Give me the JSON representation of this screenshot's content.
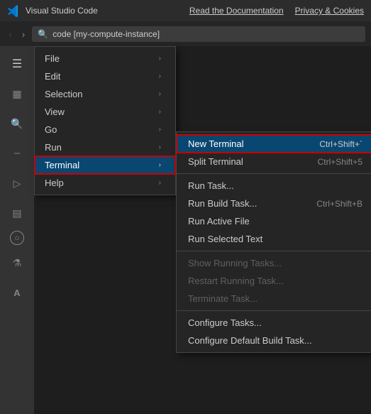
{
  "topBar": {
    "appTitle": "Visual Studio Code",
    "links": [
      "Read the Documentation",
      "Privacy & Cookies"
    ]
  },
  "addressBar": {
    "backBtn": "‹",
    "forwardBtn": "›",
    "searchIcon": "🔍",
    "addressText": "code [my-compute-instance]"
  },
  "activityBar": {
    "icons": [
      {
        "name": "hamburger",
        "symbol": "☰",
        "active": false
      },
      {
        "name": "explorer",
        "symbol": "⧉",
        "active": false
      },
      {
        "name": "search",
        "symbol": "🔍",
        "active": false
      },
      {
        "name": "source-control",
        "symbol": "⎇",
        "active": false
      },
      {
        "name": "run",
        "symbol": "▷",
        "active": false
      },
      {
        "name": "extensions",
        "symbol": "⊞",
        "active": false
      },
      {
        "name": "remote",
        "symbol": "⊙",
        "active": false
      },
      {
        "name": "flask",
        "symbol": "🧪",
        "active": false
      },
      {
        "name": "account",
        "symbol": "A",
        "active": false
      }
    ]
  },
  "fileMenu": {
    "items": [
      {
        "label": "File",
        "hasArrow": true
      },
      {
        "label": "Edit",
        "hasArrow": true
      },
      {
        "label": "Selection",
        "hasArrow": true
      },
      {
        "label": "View",
        "hasArrow": true
      },
      {
        "label": "Go",
        "hasArrow": true
      },
      {
        "label": "Run",
        "hasArrow": true
      },
      {
        "label": "Terminal",
        "hasArrow": true,
        "highlighted": true
      },
      {
        "label": "Help",
        "hasArrow": true
      }
    ]
  },
  "terminalSubmenu": {
    "items": [
      {
        "label": "New Terminal",
        "shortcut": "Ctrl+Shift+`",
        "highlighted": true,
        "disabled": false
      },
      {
        "label": "Split Terminal",
        "shortcut": "Ctrl+Shift+5",
        "highlighted": false,
        "disabled": false
      },
      {
        "label": "",
        "separator": true
      },
      {
        "label": "Run Task...",
        "shortcut": "",
        "highlighted": false,
        "disabled": false
      },
      {
        "label": "Run Build Task...",
        "shortcut": "Ctrl+Shift+B",
        "highlighted": false,
        "disabled": false
      },
      {
        "label": "Run Active File",
        "shortcut": "",
        "highlighted": false,
        "disabled": false
      },
      {
        "label": "Run Selected Text",
        "shortcut": "",
        "highlighted": false,
        "disabled": false
      },
      {
        "label": "",
        "separator": true
      },
      {
        "label": "Show Running Tasks...",
        "shortcut": "",
        "highlighted": false,
        "disabled": true
      },
      {
        "label": "Restart Running Task...",
        "shortcut": "",
        "highlighted": false,
        "disabled": true
      },
      {
        "label": "Terminate Task...",
        "shortcut": "",
        "highlighted": false,
        "disabled": true
      },
      {
        "label": "",
        "separator": true
      },
      {
        "label": "Configure Tasks...",
        "shortcut": "",
        "highlighted": false,
        "disabled": false
      },
      {
        "label": "Configure Default Build Task...",
        "shortcut": "",
        "highlighted": false,
        "disabled": false
      }
    ]
  }
}
